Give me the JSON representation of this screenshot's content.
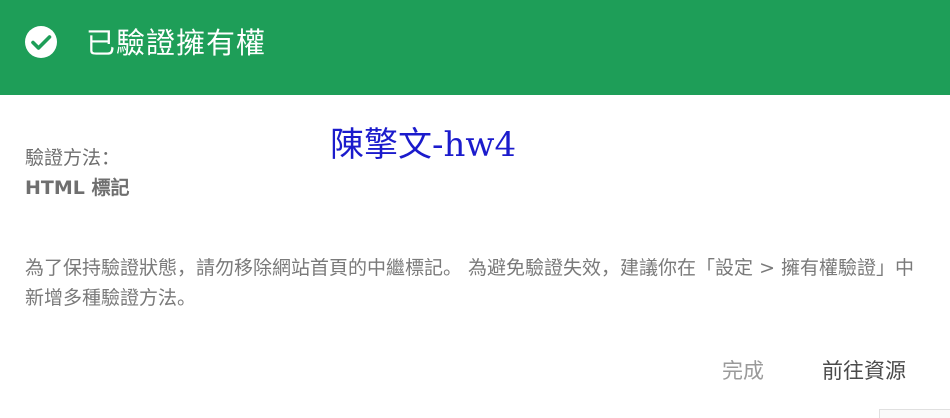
{
  "header": {
    "title": "已驗證擁有權",
    "icon": "check-circle-icon",
    "background_color": "#1e9e58"
  },
  "method": {
    "label": "驗證方法：",
    "value": "HTML 標記"
  },
  "overlay": {
    "text": "陳擎文-hw4",
    "color": "#1b1bcc"
  },
  "notice": {
    "text": "為了保持驗證狀態，請勿移除網站首頁的中繼標記。 為避免驗證失效，建議你在「設定 > 擁有權驗證」中新增多種驗證方法。"
  },
  "actions": {
    "done_label": "完成",
    "go_label": "前往資源"
  }
}
